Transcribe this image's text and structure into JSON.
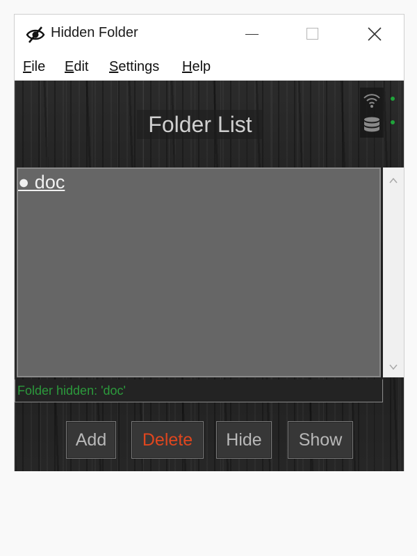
{
  "window": {
    "title": "Hidden Folder",
    "controls": {
      "minimize": "minimize",
      "maximize": "maximize",
      "close": "close"
    }
  },
  "menu": [
    {
      "accel": "F",
      "rest": "ile"
    },
    {
      "accel": "E",
      "rest": "dit"
    },
    {
      "accel": "S",
      "rest": "ettings"
    },
    {
      "accel": "H",
      "rest": "elp"
    }
  ],
  "header": {
    "title": "Folder List",
    "status_icons": [
      "wifi-icon",
      "database-icon"
    ],
    "status_color": "#1fa33a"
  },
  "folders": {
    "items": [
      "● doc"
    ]
  },
  "status": {
    "text": "Folder hidden: 'doc'",
    "color": "#2c9a3c"
  },
  "buttons": {
    "add": "Add",
    "delete": "Delete",
    "delete_color": "#e0461e",
    "hide": "Hide",
    "show": "Show"
  }
}
